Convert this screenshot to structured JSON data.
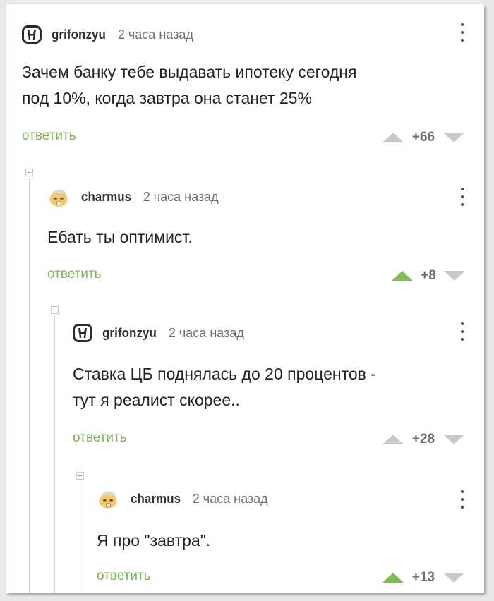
{
  "comments": [
    {
      "username": "grifonzyu",
      "time": "2 часа назад",
      "text_lines": [
        "Зачем банку тебе выдавать ипотеку сегодня",
        "под 10%, когда завтра она станет 25%"
      ],
      "reply_label": "ответить",
      "score": "+66",
      "upvoted": false,
      "avatar": "honda-logo-avatar"
    },
    {
      "username": "charmus",
      "time": "2 часа назад",
      "text_lines": [
        "Ебать ты оптимист."
      ],
      "reply_label": "ответить",
      "score": "+8",
      "upvoted": true,
      "avatar": "face-emoji-avatar"
    },
    {
      "username": "grifonzyu",
      "time": "2 часа назад",
      "text_lines": [
        "Ставка ЦБ поднялась до 20 процентов -",
        "тут я реалист скорее.."
      ],
      "reply_label": "ответить",
      "score": "+28",
      "upvoted": false,
      "avatar": "honda-logo-avatar"
    },
    {
      "username": "charmus",
      "time": "2 часа назад",
      "text_lines": [
        "Я про \"завтра\"."
      ],
      "reply_label": "ответить",
      "score": "+13",
      "upvoted": true,
      "avatar": "face-emoji-avatar"
    }
  ],
  "colors": {
    "reply_green": "#7fb15a",
    "upvote_active": "#7cc04b",
    "arrow_inactive": "#c9c9c9"
  }
}
